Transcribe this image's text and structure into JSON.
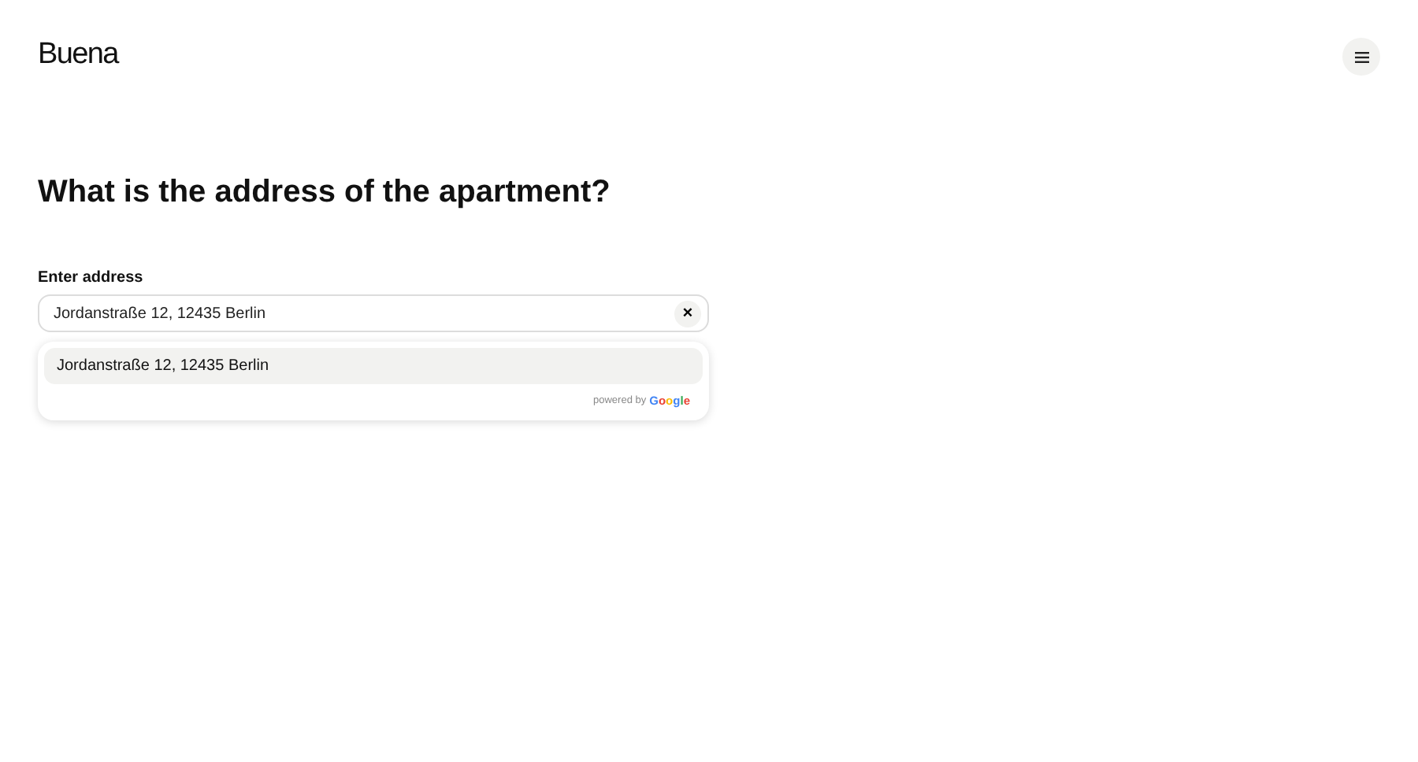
{
  "header": {
    "logo": "Buena"
  },
  "question": "What is the address of the apartment?",
  "address_field": {
    "label": "Enter address",
    "value": "Jordanstraße 12, 12435 Berlin",
    "clear_icon": "×"
  },
  "suggestions": [
    {
      "label": "Jordanstraße 12, 12435 Berlin",
      "selected": true
    }
  ],
  "attribution": {
    "prefix": "powered by",
    "brand": "Google"
  }
}
